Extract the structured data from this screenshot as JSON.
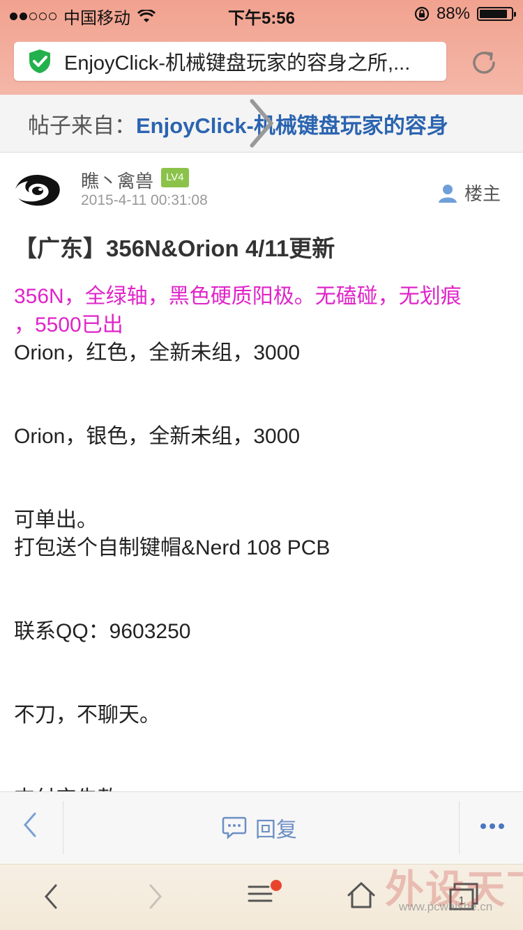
{
  "status": {
    "carrier": "中国移动",
    "time": "下午5:56",
    "battery": "88%",
    "battery_level": 0.88
  },
  "browser": {
    "url_title": "EnjoyClick-机械键盘玩家的容身之所,..."
  },
  "source": {
    "label": "帖子来自：",
    "forum": "EnjoyClick-机械键盘玩家的容身"
  },
  "post": {
    "author": "瞧丶禽兽",
    "level": "LV4",
    "date": "2015-4-11 00:31:08",
    "owner_label": "楼主",
    "title": "【广东】356N&Orion 4/11更新",
    "lines": [
      "356N，全绿轴，黑色硬质阳极。无磕碰，无划痕",
      "，5500已出",
      "Orion，红色，全新未组，3000",
      "Orion，银色，全新未组，3000",
      "可单出。",
      "打包送个自制键帽&Nerd 108 PCB",
      "联系QQ：9603250",
      "不刀，不聊天。",
      "支付宝先款"
    ]
  },
  "replybar": {
    "reply_label": "回复"
  },
  "watermark": {
    "text": "外设天下",
    "site": "www.pcwaishe.cn"
  },
  "colors": {
    "accent_pink": "#e024c8",
    "link_blue": "#2b64b0",
    "level_green": "#8bc34a"
  }
}
